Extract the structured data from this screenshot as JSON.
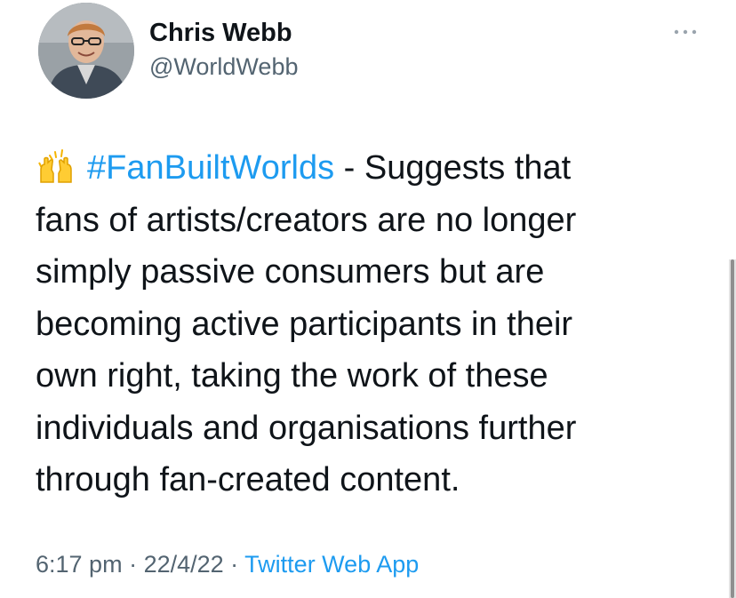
{
  "author": {
    "display_name": "Chris Webb",
    "handle": "@WorldWebb",
    "avatar_icon": "profile-photo"
  },
  "tweet": {
    "emoji": "raising-hands-emoji",
    "hashtag": "#FanBuiltWorlds",
    "lines": [
      " - Suggests that",
      "fans of artists/creators are no longer",
      "simply passive consumers but are",
      "becoming active participants in their",
      "own right, taking the work of these",
      "individuals and organisations further",
      "through fan-created content."
    ]
  },
  "meta": {
    "time": "6:17 pm",
    "separator": " · ",
    "date": "22/4/22",
    "source": "Twitter Web App"
  },
  "colors": {
    "link": "#1d9bf0",
    "text": "#0f1419",
    "secondary": "#536471"
  }
}
